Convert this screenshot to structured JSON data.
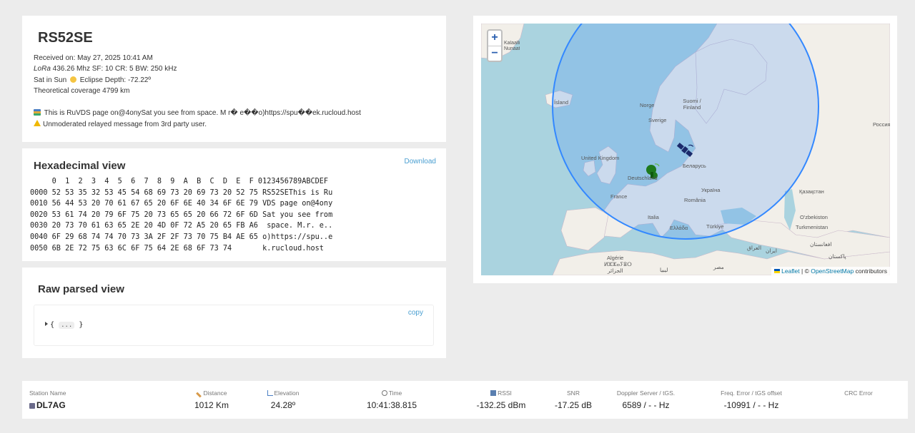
{
  "info": {
    "title": "RS52SE",
    "received": "Received on: May 27, 2025 10:41 AM",
    "lora_label": "LoRa",
    "lora_rest": " 436.26 Mhz SF: 10 CR: 5 BW: 250 kHz",
    "sat_sun_a": "Sat in Sun",
    "sat_sun_b": "Eclipse Depth: -72.22º",
    "coverage": "Theoretical coverage 4799 km",
    "message": "This is RuVDS page on@4onySat you see from space. M r� e��o)https://spu��ek.rucloud.host",
    "warning": "Unmoderated relayed message from 3rd party user."
  },
  "hex": {
    "title": "Hexadecimal view",
    "download_label": "Download",
    "header": "     0  1  2  3  4  5  6  7  8  9  A  B  C  D  E  F 0123456789ABCDEF",
    "rows": [
      "0000 52 53 35 32 53 45 54 68 69 73 20 69 73 20 52 75 RS52SEThis is Ru",
      "0010 56 44 53 20 70 61 67 65 20 6F 6E 40 34 6F 6E 79 VDS page on@4ony",
      "0020 53 61 74 20 79 6F 75 20 73 65 65 20 66 72 6F 6D Sat you see from",
      "0030 20 73 70 61 63 65 2E 20 4D 0F 72 A5 20 65 FB A6  space. M.r. e..",
      "0040 6F 29 68 74 74 70 73 3A 2F 2F 73 70 75 B4 AE 65 o)https://spu..e",
      "0050 6B 2E 72 75 63 6C 6F 75 64 2E 68 6F 73 74       k.rucloud.host"
    ]
  },
  "raw": {
    "title": "Raw parsed view",
    "copy_label": "copy",
    "tree_open": "{",
    "tree_dots": "...",
    "tree_close": "}"
  },
  "map": {
    "zoom_in": "+",
    "zoom_out": "−",
    "attr_leaflet": "Leaflet",
    "attr_sep": " | © ",
    "attr_osm": "OpenStreetMap",
    "attr_tail": " contributors",
    "labels": {
      "island": "Ísland",
      "norge": "Norge",
      "suomi": "Suomi / Finland",
      "sverige": "Sverige",
      "uk": "United Kingdom",
      "belarus": "Беларусь",
      "deutschland": "Deutschland",
      "france": "France",
      "ukraine": "Україна",
      "kazakhstan": "Қазақстан",
      "romania": "România",
      "italia": "Italia",
      "turkiye": "Türkiye",
      "ellada": "Ελλάδα",
      "uzbekistan": "O'zbekiston",
      "turkmenistan": "Turkmenistan",
      "algerie": "Algérie",
      "algerie2": "ⵍⵣⵣⴰⵢⴻⵔ",
      "algerie3": "الجزائر",
      "libya": "ليبيا",
      "misr": "مصر",
      "iraq": "العراق",
      "iran": "ایران",
      "afghanistan": "افغانستان",
      "pakistan": "پاکستان",
      "rossiya": "Россия",
      "kalaallit": "Kalaallit Nunaat"
    },
    "coverage_color": "#3388ff",
    "sea_color": "#aad3df",
    "land_color": "#f2efe9"
  },
  "stats": {
    "station_label": "Station Name",
    "station_value": "DL7AG",
    "distance_label": "Distance",
    "distance_value": "1012 Km",
    "elevation_label": "Elevation",
    "elevation_value": "24.28º",
    "time_label": "Time",
    "time_value": "10:41:38.815",
    "rssi_label": "RSSI",
    "rssi_value": "-132.25 dBm",
    "snr_label": "SNR",
    "snr_value": "-17.25 dB",
    "doppler_label": "Doppler Server / tGS.",
    "doppler_value": "6589 / - - Hz",
    "freq_label": "Freq. Error / tGS offset",
    "freq_value": "-10991 / - - Hz",
    "crc_label": "CRC Error",
    "crc_value": ""
  }
}
